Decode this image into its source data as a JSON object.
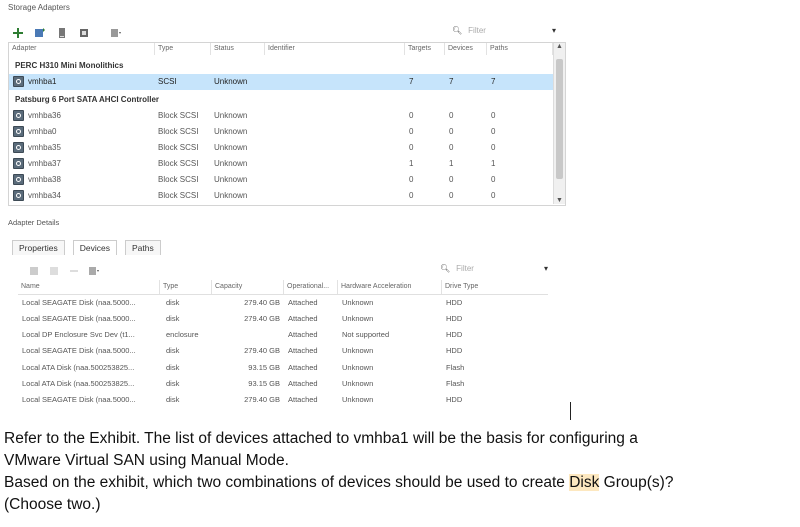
{
  "section_title": "Storage Adapters",
  "filter": {
    "placeholder": "Filter",
    "dropdown_icon": "chevron-down-icon"
  },
  "adapters": {
    "columns": [
      "Adapter",
      "Type",
      "Status",
      "Identifier",
      "Targets",
      "Devices",
      "Paths"
    ],
    "groups": [
      {
        "name": "PERC H310 Mini Monolithics",
        "rows": [
          {
            "adapter": "vmhba1",
            "type": "SCSI",
            "status": "Unknown",
            "identifier": "",
            "targets": "7",
            "devices": "7",
            "paths": "7",
            "selected": true
          }
        ]
      },
      {
        "name": "Patsburg 6 Port SATA AHCI Controller",
        "rows": [
          {
            "adapter": "vmhba36",
            "type": "Block SCSI",
            "status": "Unknown",
            "identifier": "",
            "targets": "0",
            "devices": "0",
            "paths": "0"
          },
          {
            "adapter": "vmhba0",
            "type": "Block SCSI",
            "status": "Unknown",
            "identifier": "",
            "targets": "0",
            "devices": "0",
            "paths": "0"
          },
          {
            "adapter": "vmhba35",
            "type": "Block SCSI",
            "status": "Unknown",
            "identifier": "",
            "targets": "0",
            "devices": "0",
            "paths": "0"
          },
          {
            "adapter": "vmhba37",
            "type": "Block SCSI",
            "status": "Unknown",
            "identifier": "",
            "targets": "1",
            "devices": "1",
            "paths": "1"
          },
          {
            "adapter": "vmhba38",
            "type": "Block SCSI",
            "status": "Unknown",
            "identifier": "",
            "targets": "0",
            "devices": "0",
            "paths": "0"
          },
          {
            "adapter": "vmhba34",
            "type": "Block SCSI",
            "status": "Unknown",
            "identifier": "",
            "targets": "0",
            "devices": "0",
            "paths": "0"
          }
        ]
      }
    ]
  },
  "details_title": "Adapter Details",
  "tabs": [
    "Properties",
    "Devices",
    "Paths"
  ],
  "details_filter": {
    "placeholder": "Filter"
  },
  "devices": {
    "columns": [
      "Name",
      "Type",
      "Capacity",
      "Operational...",
      "Hardware Acceleration",
      "Drive Type"
    ],
    "rows": [
      {
        "name": "Local SEAGATE Disk (naa.5000...",
        "type": "disk",
        "capacity": "279.40 GB",
        "op": "Attached",
        "hw": "Unknown",
        "drive": "HDD"
      },
      {
        "name": "Local SEAGATE Disk (naa.5000...",
        "type": "disk",
        "capacity": "279.40 GB",
        "op": "Attached",
        "hw": "Unknown",
        "drive": "HDD"
      },
      {
        "name": "Local DP Enclosure Svc Dev (t1...",
        "type": "enclosure",
        "capacity": "",
        "op": "Attached",
        "hw": "Not supported",
        "drive": "HDD"
      },
      {
        "name": "Local SEAGATE Disk (naa.5000...",
        "type": "disk",
        "capacity": "279.40 GB",
        "op": "Attached",
        "hw": "Unknown",
        "drive": "HDD"
      },
      {
        "name": "Local ATA Disk (naa.500253825...",
        "type": "disk",
        "capacity": "93.15 GB",
        "op": "Attached",
        "hw": "Unknown",
        "drive": "Flash"
      },
      {
        "name": "Local ATA Disk (naa.500253825...",
        "type": "disk",
        "capacity": "93.15 GB",
        "op": "Attached",
        "hw": "Unknown",
        "drive": "Flash"
      },
      {
        "name": "Local SEAGATE Disk (naa.5000...",
        "type": "disk",
        "capacity": "279.40 GB",
        "op": "Attached",
        "hw": "Unknown",
        "drive": "HDD"
      }
    ]
  },
  "question": {
    "line1": "Refer to the Exhibit. The list of devices attached to vmhba1 will be the basis for configuring a",
    "line2": "VMware Virtual SAN using Manual Mode.",
    "line3_pre": "Based on the exhibit, which two combinations of devices should be used to create ",
    "line3_hl": "Disk",
    "line3_post": " Group(s)?",
    "line4": "(Choose two.)"
  },
  "colors": {
    "selected_row": "#c6e4fb",
    "highlight": "#fde8c0"
  }
}
